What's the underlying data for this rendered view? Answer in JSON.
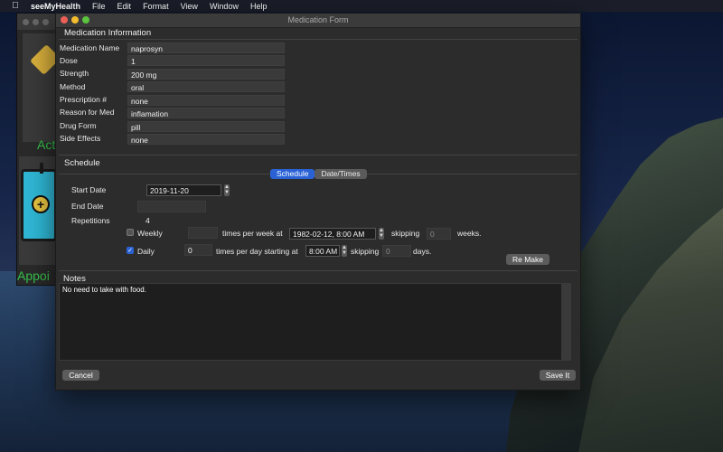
{
  "menubar": {
    "app_name": "seeMyHealth",
    "menus": [
      "File",
      "Edit",
      "Format",
      "View",
      "Window",
      "Help"
    ]
  },
  "background_app": {
    "label_top": "Act",
    "label_bottom": "Appoi"
  },
  "window": {
    "title": "Medication Form"
  },
  "medication_info": {
    "section_title": "Medication Information",
    "fields": [
      {
        "label": "Medication Name",
        "value": "naprosyn"
      },
      {
        "label": "Dose",
        "value": "1"
      },
      {
        "label": "Strength",
        "value": "200 mg"
      },
      {
        "label": "Method",
        "value": "oral"
      },
      {
        "label": "Prescription #",
        "value": "none"
      },
      {
        "label": "Reason for Med",
        "value": "inflamation"
      },
      {
        "label": "Drug Form",
        "value": "pill"
      },
      {
        "label": "Side Effects",
        "value": "none"
      }
    ]
  },
  "schedule": {
    "section_title": "Schedule",
    "tabs": [
      {
        "label": "Schedule",
        "active": true
      },
      {
        "label": "Date/Times",
        "active": false
      }
    ],
    "start_date_label": "Start Date",
    "start_date_value": "2019-11-20",
    "end_date_label": "End Date",
    "end_date_value": "",
    "repetitions_label": "Repetitions",
    "repetitions_value": "4",
    "weekly": {
      "label": "Weekly",
      "checked": false,
      "times_value": "",
      "times_text": "times per week at",
      "datetime_value": "1982-02-12,  8:00 AM",
      "skipping_text": "skipping",
      "skip_value": "0",
      "unit_text": "weeks."
    },
    "daily": {
      "label": "Daily",
      "checked": true,
      "times_value": "0",
      "times_text": "times per day starting at",
      "time_value": "8:00 AM",
      "skipping_text": "skipping",
      "skip_value": "0",
      "unit_text": "days."
    },
    "remake_label": "Re Make"
  },
  "notes": {
    "section_title": "Notes",
    "text": "No need to take with food."
  },
  "footer": {
    "cancel_label": "Cancel",
    "save_label": "Save It"
  },
  "colors": {
    "accent": "#2a62d6",
    "window_bg": "#2c2c2c"
  }
}
